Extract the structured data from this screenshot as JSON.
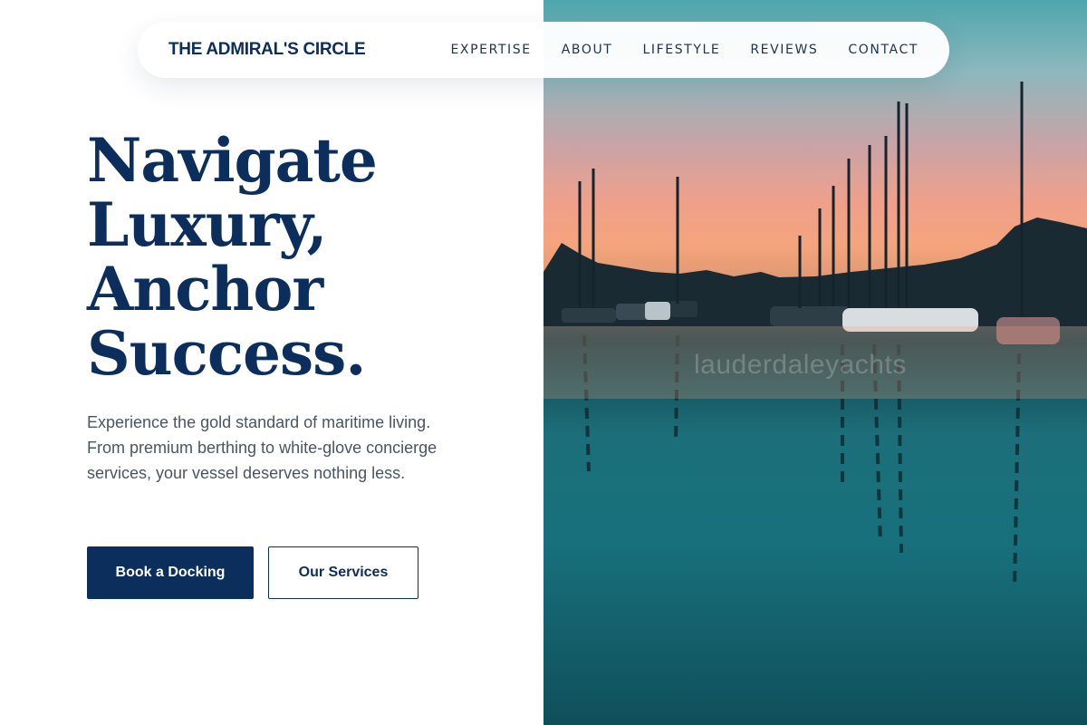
{
  "brand": {
    "name": "THE ADMIRAL'S CIRCLE"
  },
  "nav": {
    "items": [
      {
        "label": "EXPERTISE"
      },
      {
        "label": "ABOUT"
      },
      {
        "label": "LIFESTYLE"
      },
      {
        "label": "REVIEWS"
      },
      {
        "label": "CONTACT"
      }
    ]
  },
  "hero": {
    "headline": [
      "Navigate",
      "Luxury,",
      "Anchor",
      "Success."
    ],
    "subtext": "Experience the gold standard of maritime living. From premium berthing to white-glove concierge services, your vessel deserves nothing less.",
    "primary_cta": "Book a Docking",
    "secondary_cta": "Our Services"
  },
  "photo": {
    "subject": "marina with sailboat masts at sunset reflected in water",
    "watermark": "lauderdaleyachts"
  },
  "colors": {
    "navy": "#0c2e5c",
    "text_gray": "#4a5563",
    "background": "#ffffff"
  }
}
